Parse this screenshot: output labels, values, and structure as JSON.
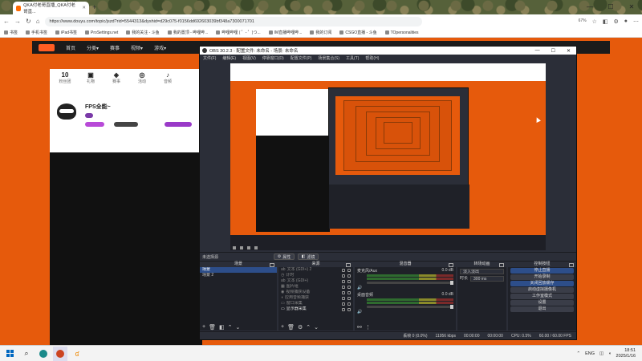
{
  "browser": {
    "tab_title": "QKA付老哥直播_QKA付老哥直...",
    "url": "https://www.douyu.com/topic/jszd?rid=5544313&dyshid=d29c075-f0156dd692603039bf348a7300071701",
    "zoom": "67%",
    "bookmarks": [
      "书签",
      "手机书签",
      "iPad书签",
      "ProSettings.net",
      "我的关注 - 斗鱼",
      "我的置顶 - 哔哩哔...",
      "哔哩哔哩 ( ゜- ゜)つ...",
      "IM直播哔哩哔...",
      "我的订阅",
      "CSGO直播 - 斗鱼",
      "TOpersonalities"
    ]
  },
  "site": {
    "nav": [
      "首页",
      "分类▾",
      "赛事",
      "视频▾",
      "游戏▾"
    ],
    "stats": [
      {
        "value": "10",
        "label": "粉丝团"
      },
      {
        "value": "",
        "label": "礼物"
      },
      {
        "value": "",
        "label": "赛事"
      },
      {
        "value": "",
        "label": "活动"
      },
      {
        "value": "",
        "label": "音频"
      }
    ],
    "streamer_name": "FPS全能~"
  },
  "obs": {
    "title": "OBS 30.2.3 - 配置文件: 未命名 - 场景: 未命名",
    "menu": [
      "文件(F)",
      "编辑(E)",
      "视图(V)",
      "停靠窗口(D)",
      "配置文件(P)",
      "场景集合(S)",
      "工具(T)",
      "帮助(H)"
    ],
    "source_bar": {
      "no_source": "未选择源",
      "properties": "属性",
      "filters": "滤镜"
    },
    "docks": {
      "scenes": {
        "title": "场景",
        "items": [
          "场景",
          "场景 2"
        ]
      },
      "sources": {
        "title": "来源",
        "items": [
          "文本 (GDI+) 2",
          "计时",
          "文本 (GDI+)",
          "图片组",
          "视频捕获设备",
          "应用音频捕获",
          "窗口采集",
          "显示器采集"
        ]
      },
      "mixer": {
        "title": "混音器",
        "channels": [
          {
            "name": "麦克风/Aux",
            "db": "0.0 dB"
          },
          {
            "name": "桌面音频",
            "db": "0.0 dB"
          }
        ]
      },
      "transitions": {
        "title": "转场动画",
        "type": "淡入淡出",
        "duration_label": "时长",
        "duration": "300 ms"
      },
      "controls": {
        "title": "控制按钮",
        "buttons": [
          "停止直播",
          "开始录制",
          "关闭回放缓存",
          "启动虚拟摄像机",
          "工作室模式",
          "设置",
          "退出"
        ]
      }
    },
    "status": {
      "dropped": "丢帧 0 (0.0%)",
      "bitrate": "11956 kbps",
      "live_time": "00:00:00",
      "rec_time": "00:00:00",
      "cpu": "CPU: 0.5%",
      "fps": "60.00 / 60.00 FPS"
    }
  },
  "taskbar": {
    "lang": "ENG",
    "time": "18:51",
    "date": "2025/1/16"
  }
}
